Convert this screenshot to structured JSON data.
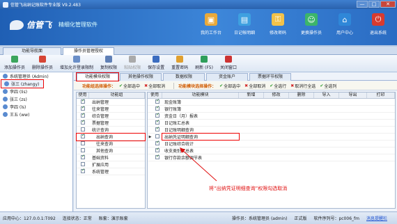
{
  "window": {
    "title": "信管飞出纳记账软件专业版 V9.2.483",
    "btn_min": "—",
    "btn_max": "□",
    "btn_close": "✕"
  },
  "banner": {
    "brand": "信管飞",
    "slogan": "精细化管理软件",
    "nav": [
      {
        "label": "我的工作台",
        "icon": "workbench-icon",
        "color": "#e9a93a",
        "glyph": "▣"
      },
      {
        "label": "日记帐明细",
        "icon": "ledger-icon",
        "color": "#3ea0e0",
        "glyph": "▤"
      },
      {
        "label": "修改密码",
        "icon": "key-icon",
        "color": "#f2c24a",
        "glyph": "⚿"
      },
      {
        "label": "更换操作员",
        "icon": "switch-user-icon",
        "color": "#3cb56a",
        "glyph": "☺"
      },
      {
        "label": "用户中心",
        "icon": "user-center-icon",
        "color": "#2f87d8",
        "glyph": "⌂"
      },
      {
        "label": "退出系统",
        "icon": "power-icon",
        "color": "#d83b2f",
        "glyph": "⏻"
      }
    ]
  },
  "doc_tabs": [
    "功能导航面",
    "操作员管理授权"
  ],
  "toolbar": [
    {
      "label": "添加操作员",
      "icon": "add-user-icon",
      "color": "#3ba55c"
    },
    {
      "label": "删除操作员",
      "icon": "delete-user-icon",
      "color": "#d64535"
    },
    {
      "label": "增加允许登录限制",
      "icon": "login-limit-icon",
      "color": "#6b8fc8"
    },
    {
      "label": "复制权限",
      "icon": "copy-icon",
      "color": "#5f7fb5"
    },
    {
      "label": "粘贴权限",
      "icon": "paste-icon",
      "color": "#aaaaaa",
      "disabled": true
    },
    {
      "label": "保存设置",
      "icon": "save-icon",
      "color": "#3b6cc0"
    },
    {
      "label": "重置密码",
      "icon": "reset-password-icon",
      "color": "#e0a030"
    },
    {
      "label": "刷新 (F5)",
      "icon": "refresh-icon",
      "color": "#2e9e5a"
    },
    {
      "label": "关闭窗口",
      "icon": "close-window-icon",
      "color": "#c33"
    }
  ],
  "users": [
    {
      "label": "系统管理员 (Admin)"
    },
    {
      "label": "张三 (zhangy)",
      "selected": true
    },
    {
      "label": "李四 (lis)"
    },
    {
      "label": "张三 (zs)"
    },
    {
      "label": "李四 (ls)"
    },
    {
      "label": "王五 (ww)"
    }
  ],
  "perm_tabs": [
    "功能模块权限",
    "其他操作权限",
    "数据权限",
    "资金账户",
    "票据环节权限"
  ],
  "opbar": {
    "group_label": "功能组选择操作：",
    "module_label": "功能模块选择操作：",
    "select_all": "全部选中",
    "cancel_all": "全部取消",
    "row_select": "全选行",
    "row_cancel": "取消行全选",
    "col_select": "全选列"
  },
  "module_grid": {
    "headers": [
      "使用",
      "功能组"
    ],
    "rows": [
      {
        "name": "出纳管理",
        "checked": true,
        "indent": false
      },
      {
        "name": "往来管理",
        "checked": true,
        "indent": false
      },
      {
        "name": "综合管理",
        "checked": true,
        "indent": false
      },
      {
        "name": "票据管理",
        "checked": true,
        "indent": false
      },
      {
        "name": "统计查询",
        "checked": false,
        "indent": false
      },
      {
        "name": "出纳查询",
        "checked": true,
        "indent": true,
        "highlight": true
      },
      {
        "name": "往来查询",
        "checked": false,
        "indent": true
      },
      {
        "name": "其他查询",
        "checked": false,
        "indent": true
      },
      {
        "name": "基础资料",
        "checked": true,
        "indent": false
      },
      {
        "name": "扩展应用",
        "checked": false,
        "indent": false
      },
      {
        "name": "系统管理",
        "checked": true,
        "indent": false
      }
    ]
  },
  "detail_grid": {
    "headers": [
      "使用",
      "功能模块",
      "新增",
      "修改",
      "删除",
      "导入",
      "导出",
      "打印"
    ],
    "rows": [
      {
        "name": "现金账簿",
        "checked": true
      },
      {
        "name": "银行账簿",
        "checked": true
      },
      {
        "name": "资金日（月）报表",
        "checked": true
      },
      {
        "name": "日记账汇总表",
        "checked": true
      },
      {
        "name": "日记账明细查询",
        "checked": true
      },
      {
        "name": "出纳凭证明细查询",
        "checked": false,
        "highlight": true,
        "current": true
      },
      {
        "name": "日记账综合统计",
        "checked": true
      },
      {
        "name": "收支类别汇总表",
        "checked": true
      },
      {
        "name": "银行存款余额调节表",
        "checked": true
      }
    ]
  },
  "annotation": "将“出纳凭证明细查询”权限勾选取消",
  "status": {
    "server": "应用中心：127.0.0.1:T092",
    "connection": "连接状态：正常",
    "account": "账套：演示账套",
    "operator": "操作员：系统管理员 (admin)",
    "edition": "正式版",
    "serial": "软件序列号：pc006_fm",
    "message": "消息提醒栏"
  }
}
